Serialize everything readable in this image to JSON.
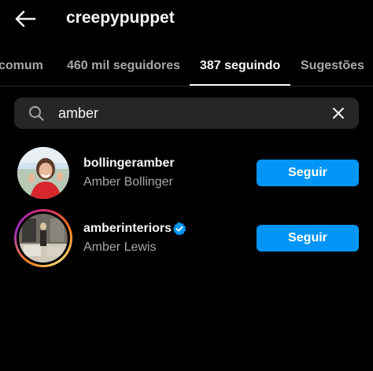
{
  "header": {
    "title": "creepypuppet",
    "back_icon": "back-arrow-icon"
  },
  "tabs": [
    {
      "label": "comum",
      "active": false
    },
    {
      "label": "460 mil seguidores",
      "active": false
    },
    {
      "label": "387 seguindo",
      "active": true
    },
    {
      "label": "Sugestões",
      "active": false
    }
  ],
  "search": {
    "value": "amber",
    "icon": "search-icon",
    "clear_icon": "close-icon"
  },
  "results": [
    {
      "username": "bollingeramber",
      "full_name": "Amber Bollinger",
      "verified": false,
      "has_story_ring": false,
      "button_label": "Seguir"
    },
    {
      "username": "amberinteriors",
      "full_name": "Amber Lewis",
      "verified": true,
      "has_story_ring": true,
      "button_label": "Seguir"
    }
  ],
  "colors": {
    "background": "#000000",
    "accent": "#0095f6",
    "primary_text": "#f5f5f5",
    "secondary_text": "#a8a8a8",
    "search_bg": "#262626",
    "verified": "#0095f6"
  }
}
